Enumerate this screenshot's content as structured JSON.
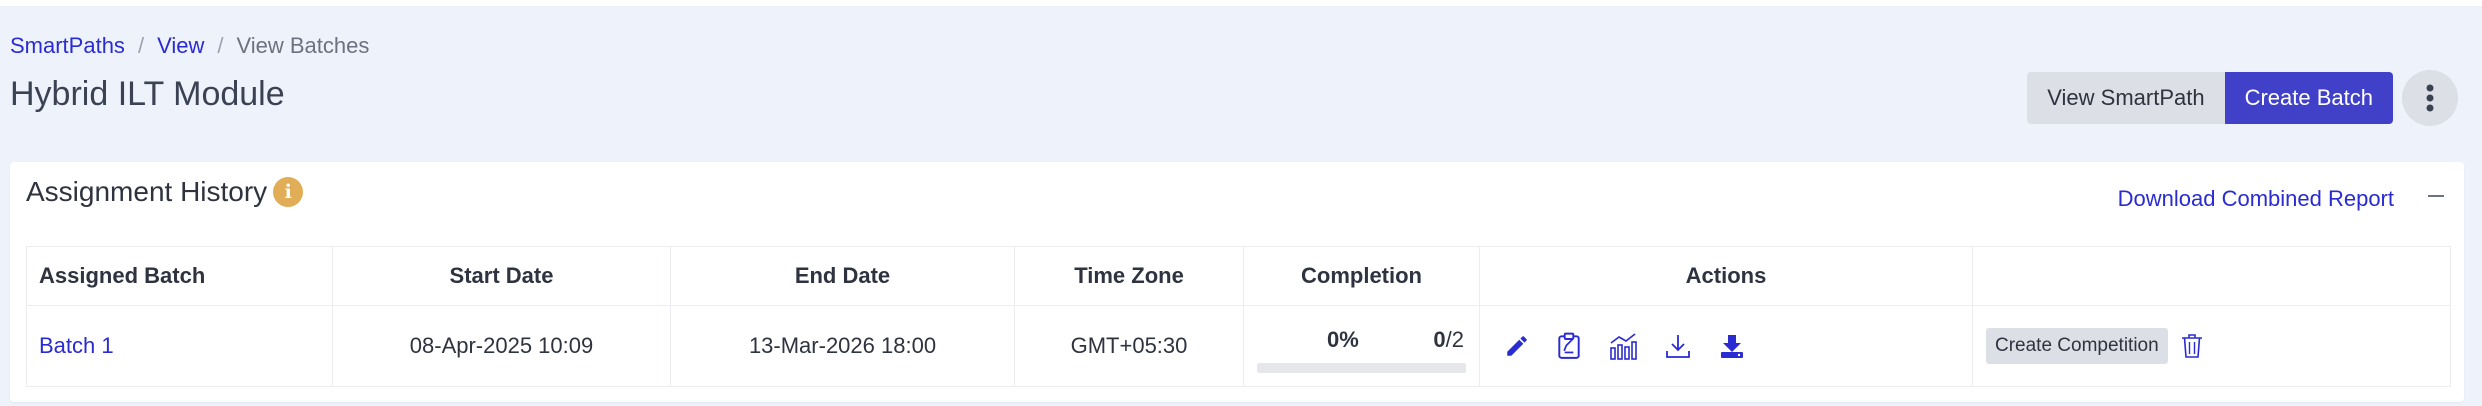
{
  "breadcrumb": {
    "items": [
      "SmartPaths",
      "View"
    ],
    "current": "View Batches"
  },
  "page": {
    "title": "Hybrid ILT Module"
  },
  "header_actions": {
    "view_smartpath": "View SmartPath",
    "create_batch": "Create Batch",
    "more_icon": "vertical-ellipsis-icon"
  },
  "panel": {
    "title": "Assignment History",
    "info_icon": "i",
    "download_combined_report": "Download Combined Report",
    "collapse_icon": "minus-icon"
  },
  "table": {
    "headers": [
      "Assigned Batch",
      "Start Date",
      "End Date",
      "Time Zone",
      "Completion",
      "Actions",
      ""
    ],
    "rows": [
      {
        "batch": "Batch 1",
        "start_date": "08-Apr-2025 10:09",
        "end_date": "13-Mar-2026 18:00",
        "time_zone": "GMT+05:30",
        "completion_pct": "0%",
        "completion_done": "0",
        "completion_total": "/2",
        "completion_fraction": 0,
        "action_icons": [
          "edit-pencil-icon",
          "clipboard-icon",
          "analytics-icon",
          "download-outline-icon",
          "download-filled-icon"
        ],
        "create_competition": "Create Competition",
        "delete_icon": "trash-icon"
      }
    ]
  },
  "colors": {
    "accent": "#4140c8",
    "link": "#2a2bd1",
    "info": "#e2ad57",
    "background": "#eef3fb"
  }
}
